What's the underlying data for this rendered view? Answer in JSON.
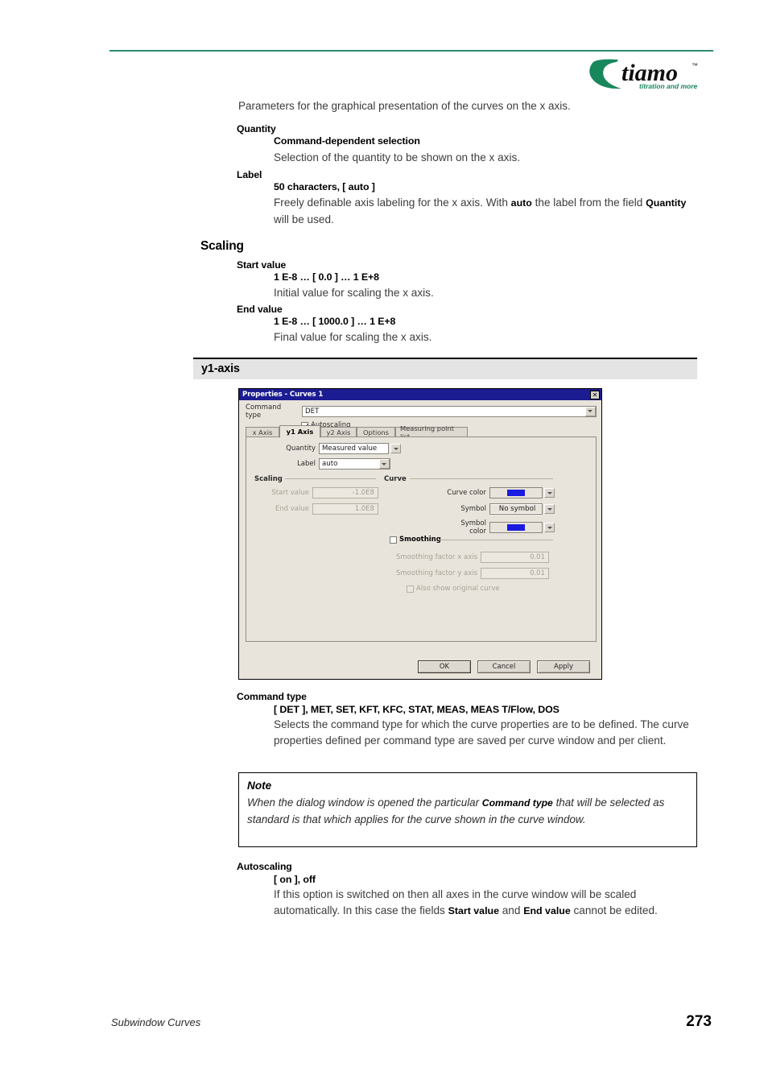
{
  "brand": {
    "logo_word": "tiamo",
    "logo_tm": "™",
    "logo_tagline": "titration and more",
    "rule_color": "#2e8b6f",
    "logo_green": "#18875c"
  },
  "intro": {
    "paragraph": "Parameters for the graphical presentation of the curves on the x axis."
  },
  "x_axis_params": [
    {
      "term": "Quantity",
      "value": "Command-dependent selection",
      "description": "Selection of the quantity to be shown on the x axis."
    },
    {
      "term": "Label",
      "value": "50 characters, [ auto ]",
      "description_prefix": "Freely definable axis labeling for the x axis. With ",
      "description_bold1": "auto",
      "description_mid": " the label from the field ",
      "description_bold2": "Quantity",
      "description_suffix": " will be used."
    }
  ],
  "scaling_section": {
    "heading": "Scaling",
    "items": [
      {
        "term": "Start value",
        "value": "1 E-8 … [ 0.0 ] … 1 E+8",
        "description": "Initial value for scaling the x axis."
      },
      {
        "term": "End value",
        "value": "1 E-8 … [ 1000.0 ] … 1 E+8",
        "description": "Final value for scaling the x axis."
      }
    ]
  },
  "section_band": {
    "label": "y1-axis"
  },
  "dialog": {
    "title": "Properties - Curves 1",
    "close_label": "✕",
    "command_type": {
      "label": "Command type",
      "value": "DET"
    },
    "autoscaling": {
      "label": "Autoscaling",
      "checked": true
    },
    "tabs": [
      {
        "label": "x Axis",
        "active": false
      },
      {
        "label": "y1 Axis",
        "active": true
      },
      {
        "label": "y2 Axis",
        "active": false
      },
      {
        "label": "Options",
        "active": false
      },
      {
        "label": "Measuring point list",
        "active": false
      }
    ],
    "quantity": {
      "label": "Quantity",
      "value": "Measured value"
    },
    "label_field": {
      "label": "Label",
      "value": "auto"
    },
    "scaling_group": {
      "title": "Scaling",
      "start_label": "Start value",
      "start_value": "-1.0E8",
      "end_label": "End value",
      "end_value": "1.0E8"
    },
    "curve_group": {
      "title": "Curve",
      "curve_color_label": "Curve color",
      "curve_color_value": "#1a1ae0",
      "symbol_label": "Symbol",
      "symbol_value": "No symbol",
      "symbol_color_label": "Symbol color",
      "symbol_color_value": "#1a1ae0"
    },
    "smoothing_group": {
      "title": "Smoothing",
      "checked": false,
      "factor_x_label": "Smoothing factor x axis",
      "factor_x_value": "0.01",
      "factor_y_label": "Smoothing factor y axis",
      "factor_y_value": "0.01",
      "original_curve_label": "Also show original curve",
      "original_curve_checked": false
    },
    "buttons": {
      "ok": "OK",
      "cancel": "Cancel",
      "apply": "Apply"
    }
  },
  "command_type_doc": {
    "term": "Command type",
    "value": "[ DET ], MET, SET, KFT, KFC, STAT, MEAS, MEAS T/Flow, DOS",
    "description": "Selects the command type for which the curve properties are to be defined. The curve properties defined per command type are saved per curve window and per client."
  },
  "note": {
    "title": "Note",
    "text_prefix": "When the dialog window is opened the particular ",
    "text_bold": "Command type",
    "text_suffix": " that will be selected as standard is that which applies for the curve shown in the curve window."
  },
  "autoscaling_doc": {
    "term": "Autoscaling",
    "value": "[ on ], off",
    "description_prefix": "If this option is switched on then all axes in the curve window will be scaled automatically. In this case the fields ",
    "description_bold1": "Start value",
    "description_mid": " and ",
    "description_bold2": "End value",
    "description_suffix": " cannot be edited."
  },
  "footer": {
    "left": "Subwindow Curves",
    "page_number": "273"
  }
}
